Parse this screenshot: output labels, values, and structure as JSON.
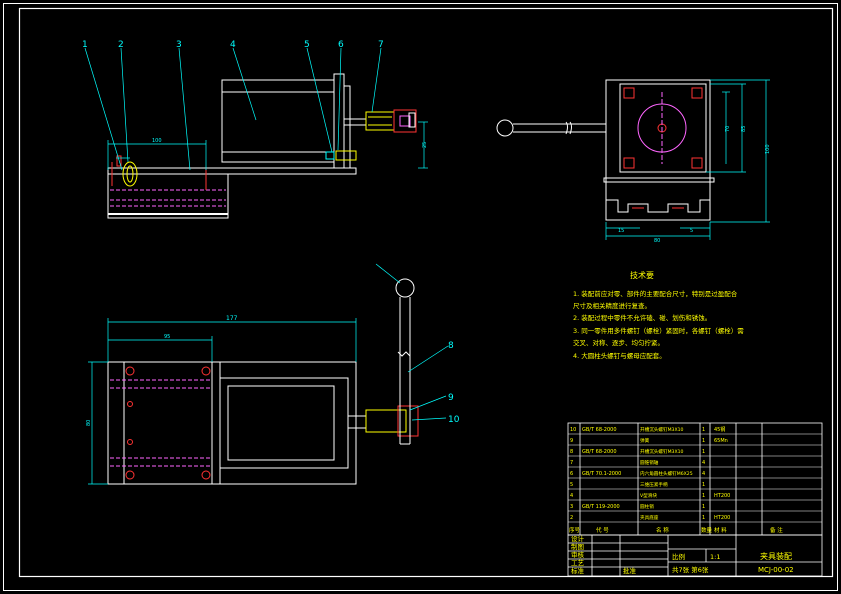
{
  "balloons": [
    "1",
    "2",
    "3",
    "4",
    "5",
    "6",
    "7",
    "8",
    "9",
    "10"
  ],
  "dimensions": {
    "top_width": "100",
    "top_height": "25",
    "plan_overall": "177",
    "plan_inner": "95",
    "plan_height": "80",
    "side_a": "100",
    "side_b": "85",
    "side_c": "70",
    "side_bottom_a": "15",
    "side_bottom_b": "80",
    "side_bottom_c": "5"
  },
  "tech_notes": {
    "title": "技术要",
    "lines": [
      "1. 装配前应对零、部件的主要配合尺寸，特别是过盈配合",
      "   尺寸及相关精度进行复查。",
      "2. 装配过程中零件不允许磕、碰、划伤和锈蚀。",
      "3. 同一零件用多件螺钉（螺栓）紧固时，各螺钉（螺栓）需",
      "   交叉、对称、逐步、均匀拧紧。",
      "4. 大圆柱头螺钉与螺母应配套。"
    ]
  },
  "bom": {
    "rows": [
      {
        "no": "10",
        "code": "GB/T 68-2000",
        "name": "开槽沉头螺钉M3X10",
        "qty": "1",
        "material": "45钢"
      },
      {
        "no": "9",
        "code": "",
        "name": "弹簧",
        "qty": "1",
        "material": "65Mn"
      },
      {
        "no": "8",
        "code": "GB/T 68-2000",
        "name": "开槽沉头螺钉M3X10",
        "qty": "1",
        "material": ""
      },
      {
        "no": "7",
        "code": "",
        "name": "圆锥销轴",
        "qty": "4",
        "material": ""
      },
      {
        "no": "6",
        "code": "GB/T 70.1-2000",
        "name": "内六角圆柱头螺钉M6X25",
        "qty": "4",
        "material": ""
      },
      {
        "no": "5",
        "code": "",
        "name": "三维压紧手柄",
        "qty": "1",
        "material": ""
      },
      {
        "no": "4",
        "code": "",
        "name": "V型滑块",
        "qty": "1",
        "material": "HT200"
      },
      {
        "no": "3",
        "code": "GB/T 119-2000",
        "name": "圆柱销",
        "qty": "1",
        "material": ""
      },
      {
        "no": "2",
        "code": "",
        "name": "夹具底座",
        "qty": "1",
        "material": "HT200"
      }
    ],
    "header": {
      "no": "序号",
      "code": "代 号",
      "name": "名 称",
      "qty": "数量",
      "material": "材 料",
      "remarks": "备 注"
    }
  },
  "title_block": {
    "left_labels": [
      "设计",
      "制图",
      "审核",
      "工艺",
      "标准"
    ],
    "approve_label": "批准",
    "scale_label": "比例",
    "scale_value": "1:1",
    "sheets": "共7张 第6张",
    "drawing_name": "夹具装配",
    "drawing_no": "MCJ-00-02"
  }
}
